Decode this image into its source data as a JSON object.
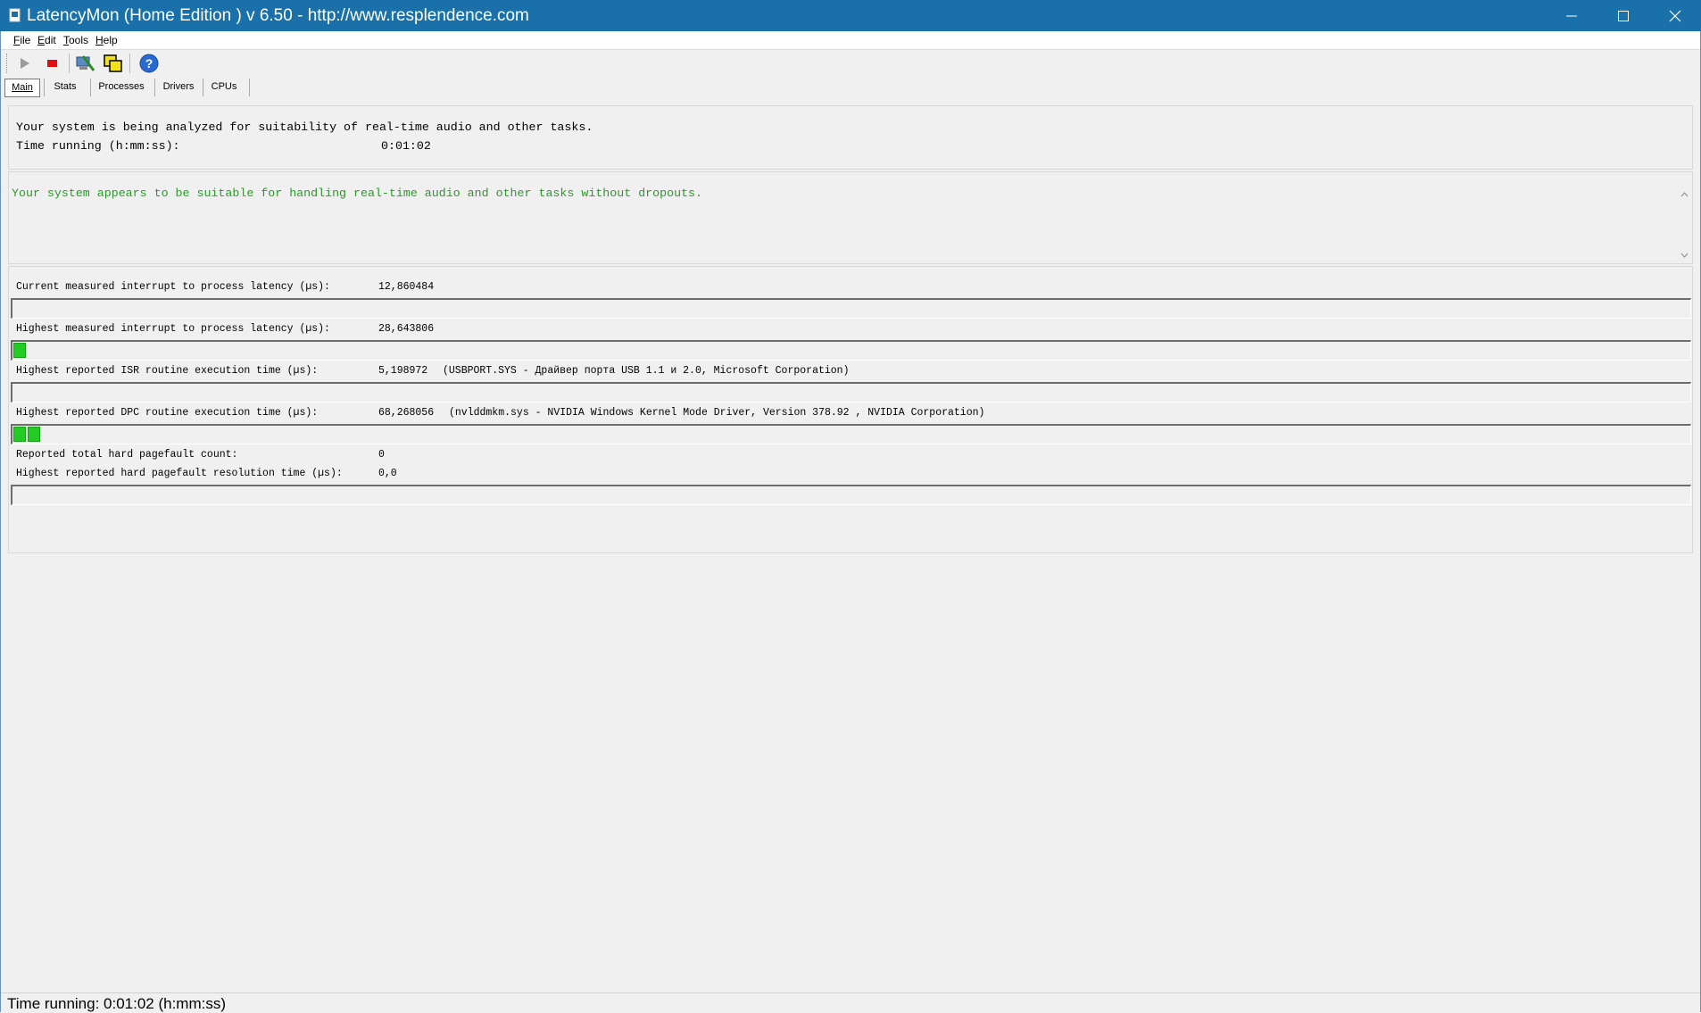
{
  "window": {
    "title": "LatencyMon  (Home Edition )  v 6.50 - http://www.resplendence.com"
  },
  "menu": [
    {
      "pre": "",
      "ul": "F",
      "post": "ile"
    },
    {
      "pre": "",
      "ul": "E",
      "post": "dit"
    },
    {
      "pre": "",
      "ul": "T",
      "post": "ools"
    },
    {
      "pre": "",
      "ul": "H",
      "post": "elp"
    }
  ],
  "tabs": [
    {
      "label": "Main"
    },
    {
      "label": "Stats"
    },
    {
      "label": "Processes"
    },
    {
      "label": "Drivers"
    },
    {
      "label": "CPUs"
    }
  ],
  "colors": {
    "titlebar": "#1a70a8",
    "status_ok": "#2a9a2a",
    "bar_fill": "#22cc22"
  },
  "analysis": {
    "line1": "Your system is being analyzed for suitability of real-time audio and other tasks.",
    "time_label": "Time running (h:mm:ss):",
    "time_value": "0:01:02"
  },
  "verdict": "Your system appears to be suitable for handling real-time audio and other tasks without dropouts.",
  "metrics": {
    "current_latency_label": "Current measured interrupt to process latency (µs):",
    "current_latency_value": "12,860484",
    "current_latency_bars": 0,
    "highest_latency_label": "Highest measured interrupt to process latency (µs):",
    "highest_latency_value": "28,643806",
    "highest_latency_bars": 1,
    "isr_label": "Highest reported ISR routine execution time (µs):",
    "isr_value": "5,198972",
    "isr_detail": "(USBPORT.SYS - Драйвер порта USB 1.1 и 2.0, Microsoft Corporation)",
    "isr_bars": 0,
    "dpc_label": "Highest reported DPC routine execution time (µs):",
    "dpc_value": "68,268056",
    "dpc_detail": "(nvlddmkm.sys - NVIDIA Windows Kernel Mode Driver, Version 378.92 , NVIDIA Corporation)",
    "dpc_bars": 2,
    "pagefault_count_label": "Reported total hard pagefault count:",
    "pagefault_count_value": "0",
    "pagefault_time_label": "Highest reported hard pagefault resolution time (µs):",
    "pagefault_time_value": "0,0",
    "pagefault_bars": 0
  },
  "statusbar": {
    "text": "Time running: 0:01:02  (h:mm:ss)"
  }
}
